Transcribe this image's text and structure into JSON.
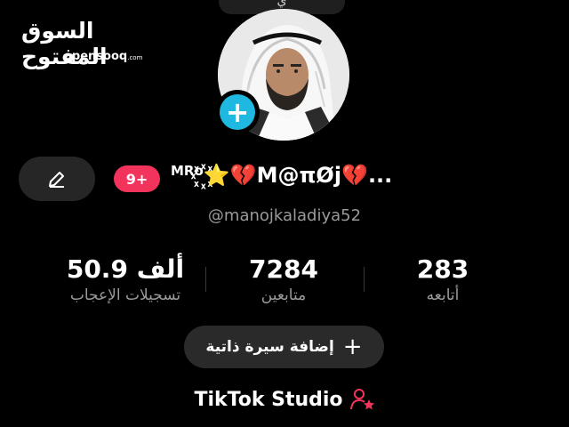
{
  "top_pill": {
    "text": "ي"
  },
  "watermark": {
    "arabic": "السوق المفتوح",
    "english": "opensooq",
    "suffix": ".com"
  },
  "profile": {
    "avatar_icon": "profile-photo",
    "add_icon": "plus-icon",
    "edit_icon": "pencil-icon",
    "badge": "9+",
    "name_prefix": "MRo",
    "name_main": "꙰⭐💔M@πØj💔...",
    "username": "@manojkaladiya52"
  },
  "stats": [
    {
      "value": "283",
      "label": "أتابعه"
    },
    {
      "value": "7284",
      "label": "متابعين"
    },
    {
      "value": "50.9 ألف",
      "label": "تسجيلات الإعجاب"
    }
  ],
  "bio_button": {
    "label": "إضافة سيرة ذاتية",
    "icon": "plus-icon"
  },
  "studio": {
    "label": "TikTok Studio",
    "icon": "person-star-icon"
  },
  "colors": {
    "accent_blue": "#1fb8e0",
    "badge_red": "#f2335b",
    "star_red": "#f2335b"
  }
}
